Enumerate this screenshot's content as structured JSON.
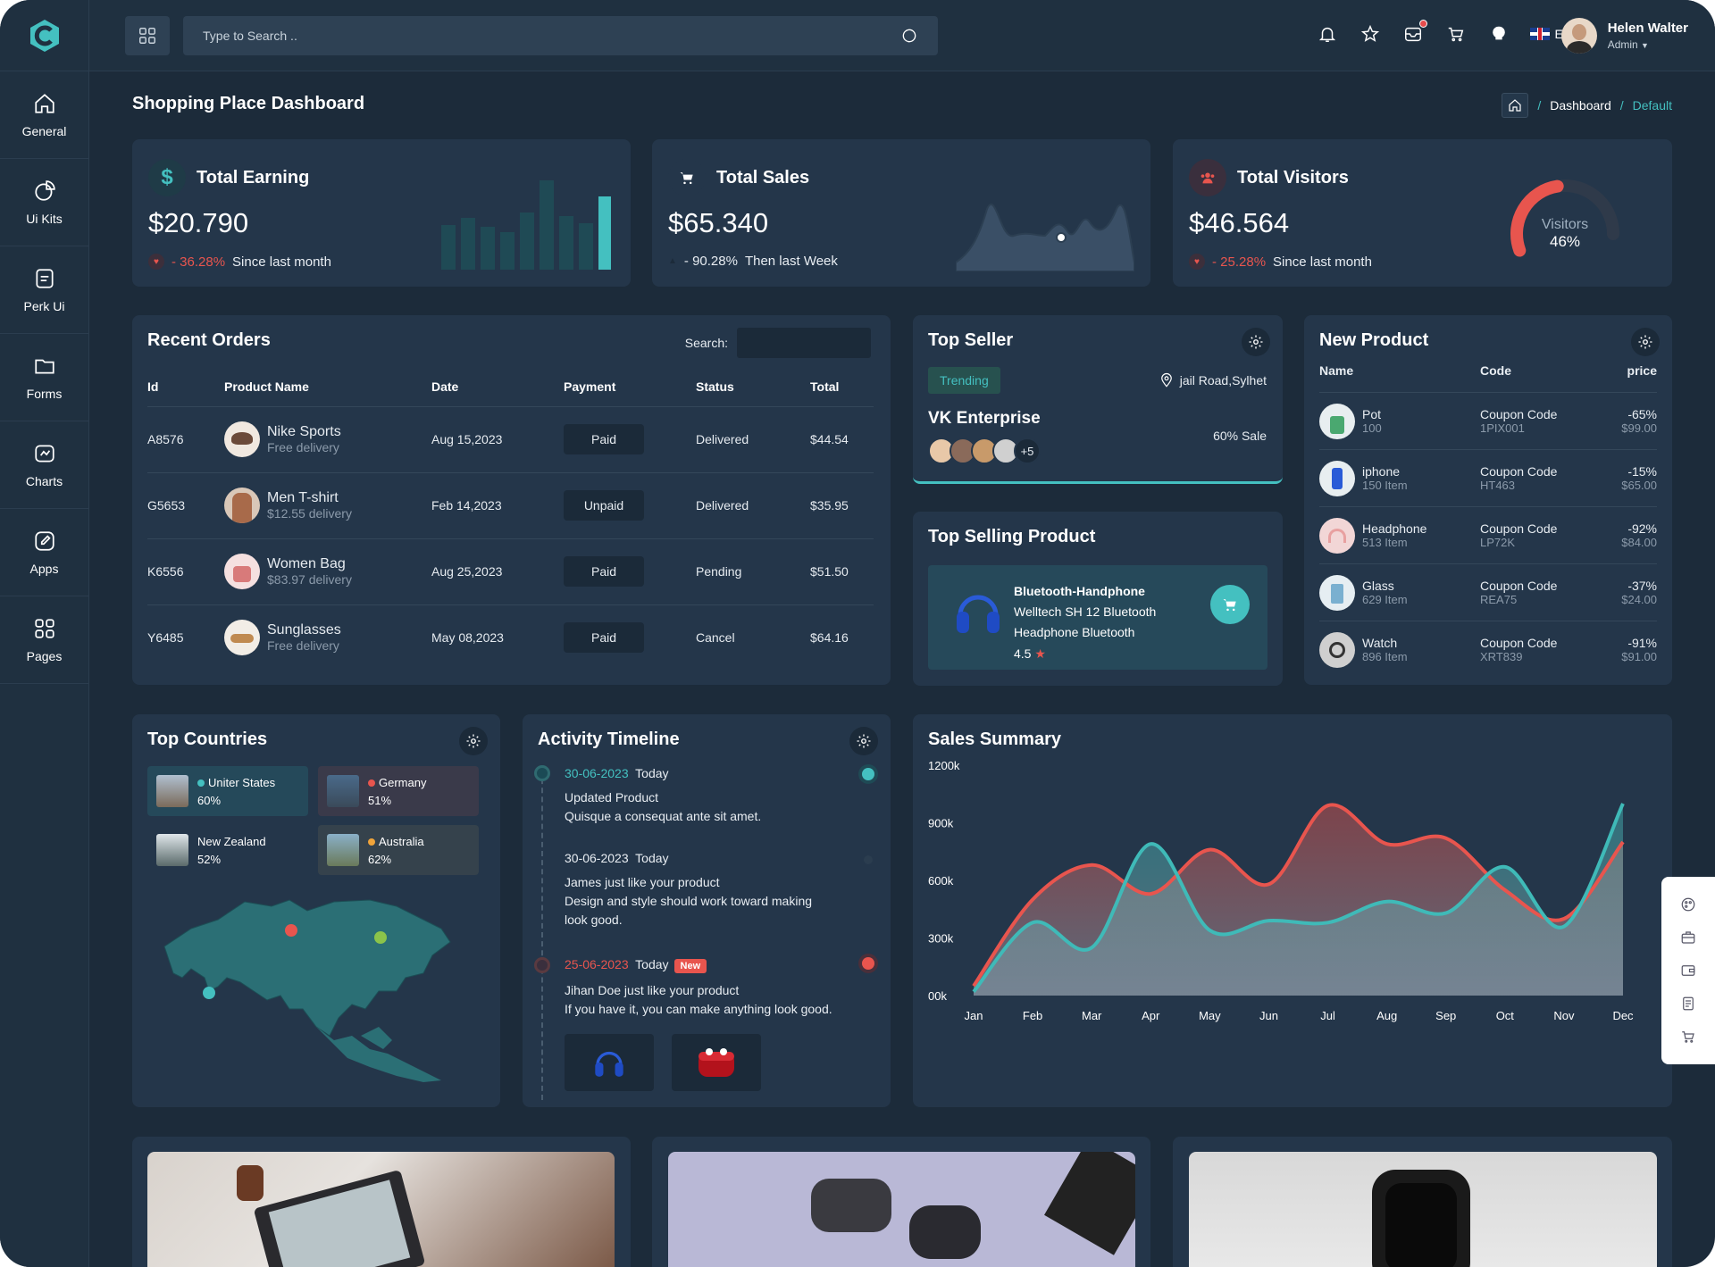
{
  "topbar": {
    "search_placeholder": "Type to Search ..",
    "language": "EN",
    "user_name": "Helen Walter",
    "user_role": "Admin"
  },
  "sidebar": {
    "items": [
      {
        "label": "General",
        "icon": "home-icon"
      },
      {
        "label": "Ui Kits",
        "icon": "pie-chart-icon"
      },
      {
        "label": "Perk Ui",
        "icon": "document-icon"
      },
      {
        "label": "Forms",
        "icon": "folder-icon"
      },
      {
        "label": "Charts",
        "icon": "chart-icon"
      },
      {
        "label": "Apps",
        "icon": "edit-icon"
      },
      {
        "label": "Pages",
        "icon": "grid-icon"
      }
    ]
  },
  "page": {
    "title": "Shopping Place Dashboard",
    "breadcrumb": [
      "Dashboard",
      "Default"
    ]
  },
  "stats": [
    {
      "title": "Total Earning",
      "value": "$20.790",
      "change": "- 36.28%",
      "note": "Since last month",
      "icon": "dollar-icon",
      "bars": [
        0.5,
        0.58,
        0.48,
        0.42,
        0.64,
        1.0,
        0.6,
        0.52,
        0.82
      ],
      "highlight_bar": 8
    },
    {
      "title": "Total Sales",
      "value": "$65.340",
      "change": "- 90.28%",
      "note": "Then last Week",
      "icon": "cart-icon"
    },
    {
      "title": "Total Visitors",
      "value": "$46.564",
      "change": "- 25.28%",
      "note": "Since last month",
      "icon": "users-icon",
      "gauge_label": "Visitors",
      "gauge_value": "46%",
      "gauge_percent": 46
    }
  ],
  "orders": {
    "title": "Recent Orders",
    "search_label": "Search:",
    "columns": [
      "Id",
      "Product Name",
      "Date",
      "Payment",
      "Status",
      "Total"
    ],
    "rows": [
      {
        "id": "A8576",
        "name": "Nike Sports",
        "sub": "Free delivery",
        "date": "Aug 15,2023",
        "payment": "Paid",
        "status": "Delivered",
        "status_type": "del",
        "total": "$44.54"
      },
      {
        "id": "G5653",
        "name": "Men T-shirt",
        "sub": "$12.55 delivery",
        "date": "Feb 14,2023",
        "payment": "Unpaid",
        "status": "Delivered",
        "status_type": "del",
        "total": "$35.95"
      },
      {
        "id": "K6556",
        "name": "Women Bag",
        "sub": "$83.97 delivery",
        "date": "Aug 25,2023",
        "payment": "Paid",
        "status": "Pending",
        "status_type": "pen",
        "total": "$51.50"
      },
      {
        "id": "Y6485",
        "name": "Sunglasses",
        "sub": "Free delivery",
        "date": "May 08,2023",
        "payment": "Paid",
        "status": "Cancel",
        "status_type": "can",
        "total": "$64.16"
      }
    ]
  },
  "top_seller": {
    "title": "Top Seller",
    "tag": "Trending",
    "location": "jail Road,Sylhet",
    "name": "VK Enterprise",
    "sale": "60% Sale",
    "more": "+5"
  },
  "top_selling": {
    "title": "Top Selling Product",
    "line1": "Bluetooth-Handphone",
    "line2": "Welltech SH 12 Bluetooth",
    "line3": "Headphone Bluetooth",
    "rating": "4.5"
  },
  "new_product": {
    "title": "New Product",
    "columns": [
      "Name",
      "Code",
      "price"
    ],
    "rows": [
      {
        "name": "Pot",
        "qty": "100",
        "code_label": "Coupon Code",
        "code": "1PIX001",
        "disc": "-65%",
        "price": "$99.00"
      },
      {
        "name": "iphone",
        "qty": "150 Item",
        "code_label": "Coupon Code",
        "code": "HT463",
        "disc": "-15%",
        "price": "$65.00"
      },
      {
        "name": "Headphone",
        "qty": "513 Item",
        "code_label": "Coupon Code",
        "code": "LP72K",
        "disc": "-92%",
        "price": "$84.00"
      },
      {
        "name": "Glass",
        "qty": "629 Item",
        "code_label": "Coupon Code",
        "code": "REA75",
        "disc": "-37%",
        "price": "$24.00"
      },
      {
        "name": "Watch",
        "qty": "896 Item",
        "code_label": "Coupon Code",
        "code": "XRT839",
        "disc": "-91%",
        "price": "$91.00"
      }
    ]
  },
  "countries": {
    "title": "Top Countries",
    "items": [
      {
        "name": "Uniter States",
        "value": "60%",
        "dot": "#44c0c0"
      },
      {
        "name": "Germany",
        "value": "51%",
        "dot": "#e8554e"
      },
      {
        "name": "New Zealand",
        "value": "52%",
        "dot": ""
      },
      {
        "name": "Australia",
        "value": "62%",
        "dot": "#f0a43a"
      }
    ]
  },
  "timeline": {
    "title": "Activity Timeline",
    "items": [
      {
        "date": "30-06-2023",
        "day": "Today",
        "heading": "Updated Product",
        "text": "Quisque a consequat ante sit amet.",
        "new": ""
      },
      {
        "date": "30-06-2023",
        "day": "Today",
        "heading": "James just like your product",
        "text": "Design and style should work toward making",
        "text2": "look good.",
        "new": ""
      },
      {
        "date": "25-06-2023",
        "day": "Today",
        "heading": "Jihan Doe just like your product",
        "text": "If you have it, you can make anything look good.",
        "new": "New"
      }
    ]
  },
  "sales_summary": {
    "title": "Sales Summary"
  },
  "chart_data": {
    "type": "area",
    "title": "Sales Summary",
    "categories": [
      "Jan",
      "Feb",
      "Mar",
      "Apr",
      "May",
      "Jun",
      "Jul",
      "Aug",
      "Sep",
      "Oct",
      "Nov",
      "Dec"
    ],
    "y_ticks": [
      "1200k",
      "900k",
      "600k",
      "300k",
      "00k"
    ],
    "ylim": [
      0,
      1200
    ],
    "series": [
      {
        "color": "#e8554e",
        "values": [
          50,
          500,
          680,
          530,
          760,
          580,
          990,
          790,
          820,
          550,
          400,
          800
        ]
      },
      {
        "color": "#3fbab8",
        "values": [
          20,
          380,
          250,
          790,
          340,
          390,
          380,
          490,
          430,
          670,
          360,
          1000
        ]
      }
    ]
  },
  "colors": {
    "accent": "#44c0c0",
    "danger": "#e8554e",
    "warning": "#f0a43a",
    "card": "#24364a",
    "background": "#1c2b3a"
  }
}
